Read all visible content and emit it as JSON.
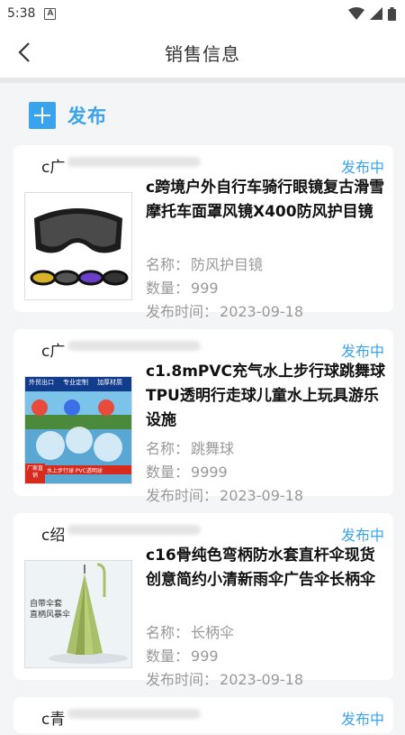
{
  "status_bar": {
    "time": "5:38",
    "a_icon": "A"
  },
  "header": {
    "title": "销售信息"
  },
  "publish": {
    "label": "发布"
  },
  "labels": {
    "name": "名称：",
    "qty": "数量：",
    "time": "发布时间："
  },
  "items": [
    {
      "shop": "c广",
      "status": "发布中",
      "title": "c跨境户外自行车骑行眼镜复古滑雪摩托车面罩风镜X400防风护目镜",
      "name": "防风护目镜",
      "qty": "999",
      "time": "2023-09-18"
    },
    {
      "shop": "c广",
      "status": "发布中",
      "title": "c1.8mPVC充气水上步行球跳舞球TPU透明行走球儿童水上玩具游乐设施",
      "name": "跳舞球",
      "qty": "9999",
      "time": "2023-09-18",
      "image_text": {
        "tag1": "外贸出口",
        "tag2": "专业定制",
        "tag3": "加厚材质",
        "badge": "厂家直销",
        "caption": "水上步行球 PVC透明球"
      }
    },
    {
      "shop": "c绍",
      "status": "发布中",
      "title": "c16骨纯色弯柄防水套直杆伞现货 创意简约小清新雨伞广告伞长柄伞",
      "name": "长柄伞",
      "qty": "999",
      "time": "2023-09-18",
      "image_text": {
        "line1": "自带伞套",
        "line2": "直柄风暴伞"
      }
    },
    {
      "shop": "c青",
      "status": "发布中"
    }
  ]
}
